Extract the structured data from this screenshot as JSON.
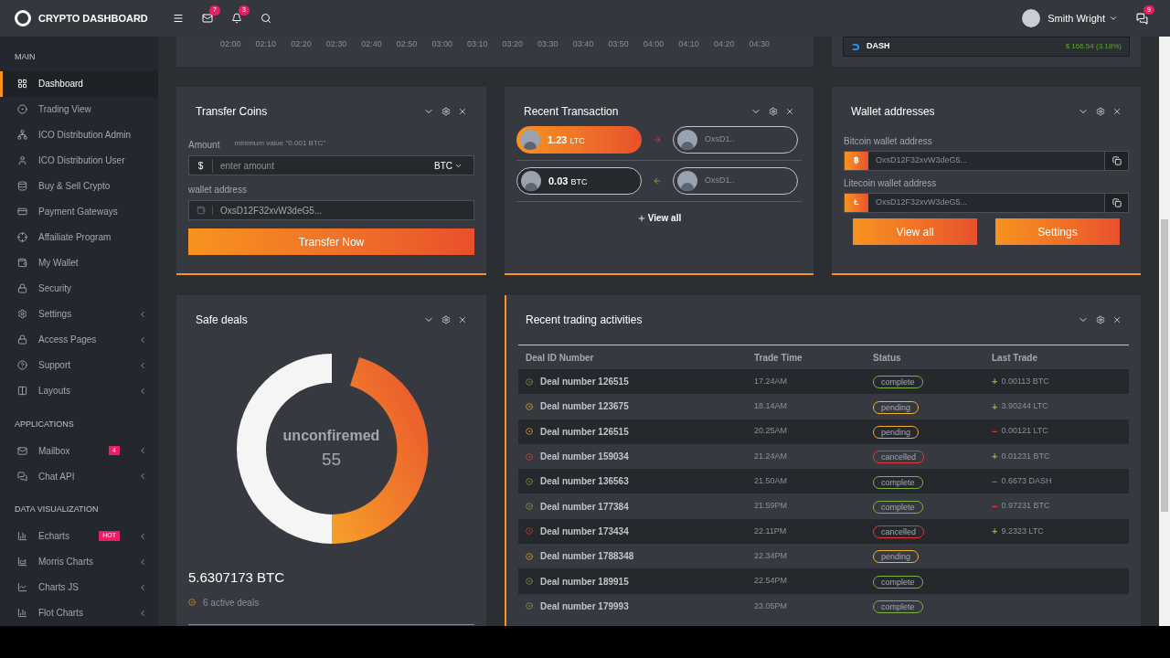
{
  "topbar": {
    "logo": "CRYPTO DASHBOARD",
    "mail_count": "7",
    "bell_count": "3",
    "user": "Smith Wright",
    "chat_count": "9"
  },
  "sidebar": [
    {
      "title": "MAIN",
      "items": [
        {
          "label": "Dashboard",
          "selected": true,
          "expandable": false
        },
        {
          "label": "Trading View",
          "selected": false,
          "expandable": false
        },
        {
          "label": "ICO Distribution Admin",
          "selected": false,
          "expandable": false
        },
        {
          "label": "ICO Distribution User",
          "selected": false,
          "expandable": false
        },
        {
          "label": "Buy & Sell Crypto",
          "selected": false,
          "expandable": false
        },
        {
          "label": "Payment Gateways",
          "selected": false,
          "expandable": false
        },
        {
          "label": "Affailiate Program",
          "selected": false,
          "expandable": false
        },
        {
          "label": "My Wallet",
          "selected": false,
          "expandable": false
        },
        {
          "label": "Security",
          "selected": false,
          "expandable": false
        },
        {
          "label": "Settings",
          "selected": false,
          "expandable": true
        },
        {
          "label": "Access Pages",
          "selected": false,
          "expandable": true
        },
        {
          "label": "Support",
          "selected": false,
          "expandable": true
        },
        {
          "label": "Layouts",
          "selected": false,
          "expandable": true
        }
      ]
    },
    {
      "title": "APPLICATIONS",
      "items": [
        {
          "label": "Mailbox",
          "selected": false,
          "expandable": true,
          "badge": "4"
        },
        {
          "label": "Chat API",
          "selected": false,
          "expandable": true
        }
      ]
    },
    {
      "title": "DATA VISUALIZATION",
      "items": [
        {
          "label": "Echarts",
          "selected": false,
          "expandable": true,
          "badge": "HOT"
        },
        {
          "label": "Morris Charts",
          "selected": false,
          "expandable": true
        },
        {
          "label": "Charts JS",
          "selected": false,
          "expandable": true
        },
        {
          "label": "Flot Charts",
          "selected": false,
          "expandable": true
        }
      ]
    }
  ],
  "chart_strip": {
    "time_labels": [
      "02:00",
      "02:10",
      "02:20",
      "02:30",
      "02:40",
      "02:50",
      "03:00",
      "03:10",
      "03:20",
      "03:30",
      "03:40",
      "03:50",
      "04:00",
      "04:10",
      "04:20",
      "04:30"
    ]
  },
  "ticker": {
    "coin": "DASH",
    "price": "$ 166.54 (3.18%)"
  },
  "transfer": {
    "title": "Transfer Coins",
    "amount_label": "Amount",
    "amount_hint": "minimum value \"0.001 BTC\"",
    "currency_symbol": "$",
    "amount_placeholder": "enter amount",
    "currency": "BTC",
    "wallet_label": "wallet address",
    "wallet_value": "OxsD12F32xvW3deG5...",
    "button": "Transfer Now"
  },
  "recent_transaction": {
    "title": "Recent Transaction",
    "rows": [
      {
        "amount": "1.23",
        "unit": "LTC",
        "highlighted": true,
        "kind": "outgoing",
        "to": "OxsD1.."
      },
      {
        "amount": "0.03",
        "unit": "BTC",
        "highlighted": false,
        "kind": "incoming",
        "to": "OxsD1.."
      }
    ],
    "view_all": "View all"
  },
  "wallets": {
    "title": "Wallet addresses",
    "items": [
      {
        "label": "Bitcoin wallet address",
        "coin_symbol": "฿",
        "address": "OxsD12F32xvW3deG5..."
      },
      {
        "label": "Litecoin wallet address",
        "coin_symbol": "Ł",
        "address": "OxsD12F32xvW3deG5..."
      }
    ],
    "buttons": [
      "View all",
      "Settings"
    ]
  },
  "safe_deals": {
    "title": "Safe deals",
    "center_label": "unconfiremed",
    "center_value": "55",
    "total": "5.6307173 BTC",
    "active": "6 active deals"
  },
  "trading": {
    "title": "Recent trading activities",
    "columns": [
      "Deal ID Number",
      "Trade Time",
      "Status",
      "Last Trade"
    ],
    "rows": [
      {
        "deal": "Deal number 126515",
        "time": "17.24AM",
        "status": "complete",
        "kind": "complete",
        "sign": "+",
        "color": "#7cb342",
        "trade": "0.00113 BTC"
      },
      {
        "deal": "Deal number 123675",
        "time": "18.14AM",
        "status": "pending",
        "kind": "pending",
        "sign": "+",
        "color": "#7cb342",
        "trade": "3.90244 LTC"
      },
      {
        "deal": "Deal number 126515",
        "time": "20.25AM",
        "status": "pending",
        "kind": "pending",
        "sign": "−",
        "color": "#e53935",
        "trade": "0.00121 LTC"
      },
      {
        "deal": "Deal number 159034",
        "time": "21.24AM",
        "status": "cancelled",
        "kind": "cancelled",
        "sign": "+",
        "color": "#7cb342",
        "trade": "0.01231 BTC"
      },
      {
        "deal": "Deal number 136563",
        "time": "21.50AM",
        "status": "complete",
        "kind": "complete",
        "sign": "−",
        "color": "#e53935",
        "trade": "0.6673 DASH"
      },
      {
        "deal": "Deal number 177384",
        "time": "21.59PM",
        "status": "complete",
        "kind": "complete",
        "sign": "−",
        "color": "#e53935",
        "trade": "0.97231 BTC"
      },
      {
        "deal": "Deal number 173434",
        "time": "22.11PM",
        "status": "cancelled",
        "kind": "cancelled",
        "sign": "+",
        "color": "#7cb342",
        "trade": "9.2323 LTC"
      },
      {
        "deal": "Deal number 1788348",
        "time": "22.34PM",
        "status": "pending",
        "kind": "pending"
      },
      {
        "deal": "Deal number 189915",
        "time": "22.54PM",
        "status": "complete",
        "kind": "complete"
      },
      {
        "deal": "Deal number 179993",
        "time": "23.05PM",
        "status": "complete",
        "kind": "complete"
      }
    ]
  }
}
